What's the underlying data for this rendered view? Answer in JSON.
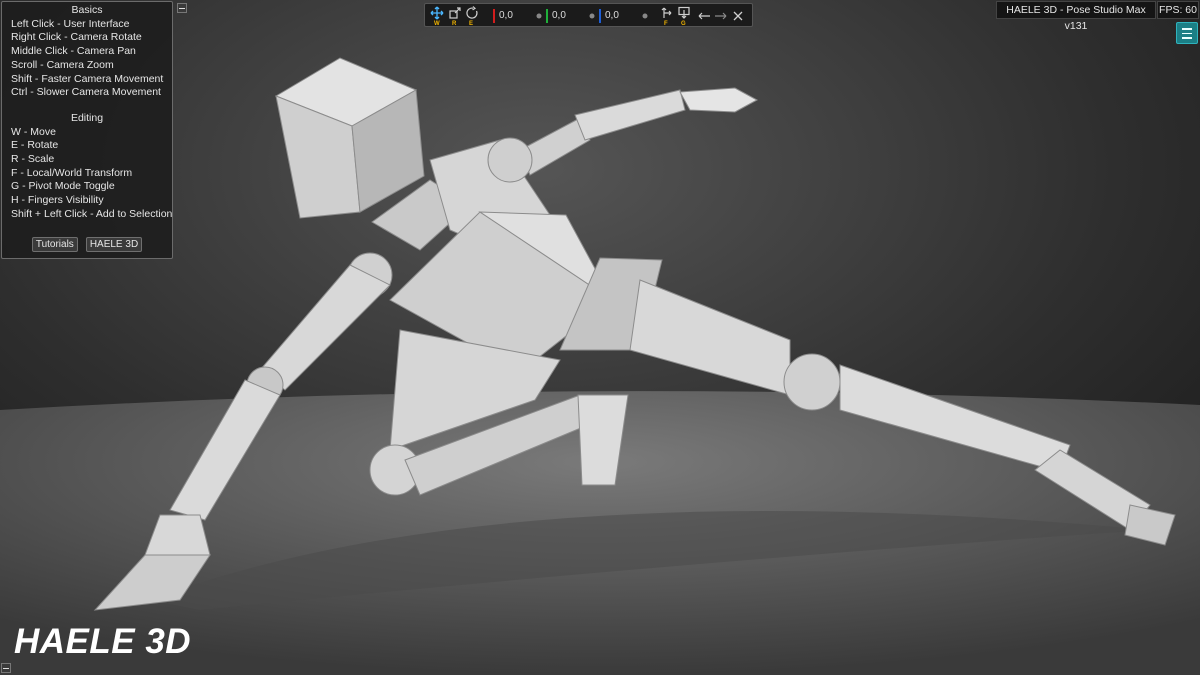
{
  "app": {
    "title": "HAELE 3D - Pose Studio Max v131",
    "fps": "FPS: 60",
    "watermark": "HAELE 3D"
  },
  "help": {
    "basics_title": "Basics",
    "basics": [
      "Left Click - User Interface",
      "Right Click - Camera Rotate",
      "Middle Click - Camera Pan",
      "Scroll - Camera Zoom",
      "Shift - Faster Camera Movement",
      "Ctrl - Slower Camera Movement"
    ],
    "editing_title": "Editing",
    "editing": [
      "W - Move",
      "E - Rotate",
      "R - Scale",
      "F - Local/World Transform",
      "G - Pivot Mode Toggle",
      "H - Fingers Visibility",
      "Shift + Left Click - Add to Selection"
    ],
    "buttons": {
      "tutorials": "Tutorials",
      "haele": "HAELE 3D"
    }
  },
  "toolbar": {
    "tools": [
      {
        "icon": "move-icon",
        "key": "W"
      },
      {
        "icon": "scale-icon",
        "key": "R"
      },
      {
        "icon": "rotate-icon",
        "key": "E"
      }
    ],
    "fields": [
      {
        "axis": "x",
        "color": "#d21d1d",
        "value": "0,0"
      },
      {
        "axis": "y",
        "color": "#1fb03a",
        "value": "0,0"
      },
      {
        "axis": "z",
        "color": "#1f5fd6",
        "value": "0,0"
      }
    ],
    "local_world_key": "F",
    "pivot_key": "G",
    "colors": {
      "hotkey": "#f0b300",
      "accent": "#2fb3bd"
    }
  }
}
